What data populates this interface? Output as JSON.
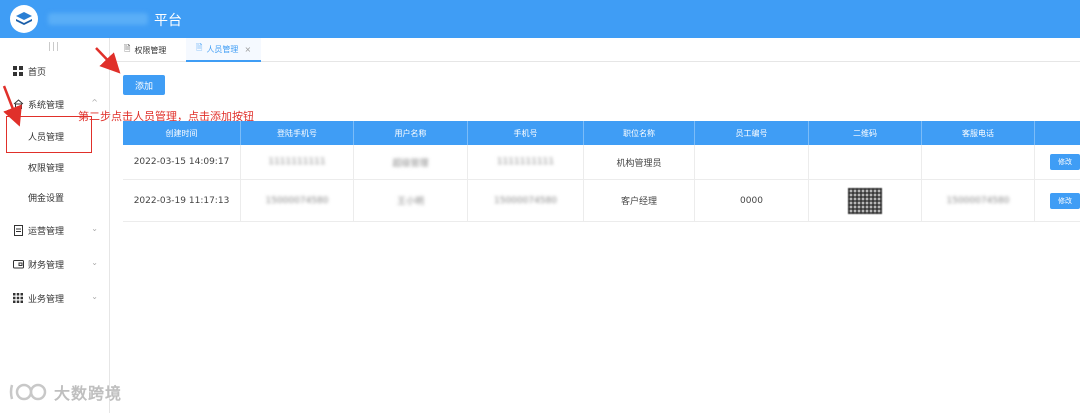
{
  "header": {
    "title": "平台"
  },
  "sidebar": {
    "items": [
      {
        "label": "首页",
        "icon": "grid-icon"
      },
      {
        "label": "系统管理",
        "icon": "home-icon",
        "expanded": true,
        "children": [
          {
            "label": "人员管理"
          },
          {
            "label": "权限管理"
          },
          {
            "label": "佣金设置"
          }
        ]
      },
      {
        "label": "运营管理",
        "icon": "document-icon"
      },
      {
        "label": "财务管理",
        "icon": "wallet-icon"
      },
      {
        "label": "业务管理",
        "icon": "apps-icon"
      }
    ]
  },
  "tabs": [
    {
      "label": "权限管理",
      "active": false
    },
    {
      "label": "人员管理",
      "active": true,
      "close": "×"
    }
  ],
  "toolbar": {
    "add_label": "添加"
  },
  "annotation": {
    "text": "第二步点击人员管理，点击添加按钮"
  },
  "table": {
    "columns": [
      "创建时间",
      "登陆手机号",
      "用户名称",
      "手机号",
      "职位名称",
      "员工编号",
      "二维码",
      "客服电话",
      ""
    ],
    "rows": [
      {
        "created": "2022-03-15 14:09:17",
        "login_phone": "1111111111",
        "name": "超级管理",
        "phone": "1111111111",
        "position": "机构管理员",
        "emp_no": "",
        "service_phone": "",
        "action": "修改"
      },
      {
        "created": "2022-03-19 11:17:13",
        "login_phone": "15000074580",
        "name": "王小明",
        "phone": "15000074580",
        "position": "客户经理",
        "emp_no": "0000",
        "service_phone": "15000074580",
        "action": "修改"
      }
    ]
  },
  "watermark": {
    "text": "大数跨境"
  },
  "colors": {
    "primary": "#3f9df5",
    "annotation": "#e0302a"
  }
}
